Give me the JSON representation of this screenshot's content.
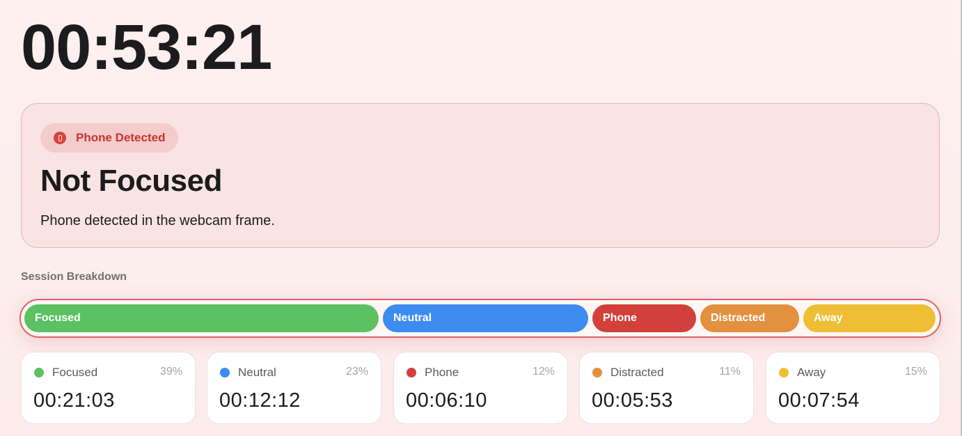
{
  "timer": {
    "elapsed": "00:53:21"
  },
  "status": {
    "badge_label": "Phone Detected",
    "badge_icon": "phone-icon",
    "title": "Not Focused",
    "description": "Phone detected in the webcam frame."
  },
  "breakdown": {
    "label": "Session Breakdown",
    "segments": [
      {
        "label": "Focused",
        "color": "#5cc163"
      },
      {
        "label": "Neutral",
        "color": "#3d8cf0"
      },
      {
        "label": "Phone",
        "color": "#d2403c"
      },
      {
        "label": "Distracted",
        "color": "#e3903f"
      },
      {
        "label": "Away",
        "color": "#eebf34"
      }
    ]
  },
  "stats": [
    {
      "name": "Focused",
      "percent": "39%",
      "time": "00:21:03",
      "color": "#5cc163"
    },
    {
      "name": "Neutral",
      "percent": "23%",
      "time": "00:12:12",
      "color": "#3d8cf0"
    },
    {
      "name": "Phone",
      "percent": "12%",
      "time": "00:06:10",
      "color": "#d2403c"
    },
    {
      "name": "Distracted",
      "percent": "11%",
      "time": "00:05:53",
      "color": "#e3903f"
    },
    {
      "name": "Away",
      "percent": "15%",
      "time": "00:07:54",
      "color": "#eebf34"
    }
  ]
}
